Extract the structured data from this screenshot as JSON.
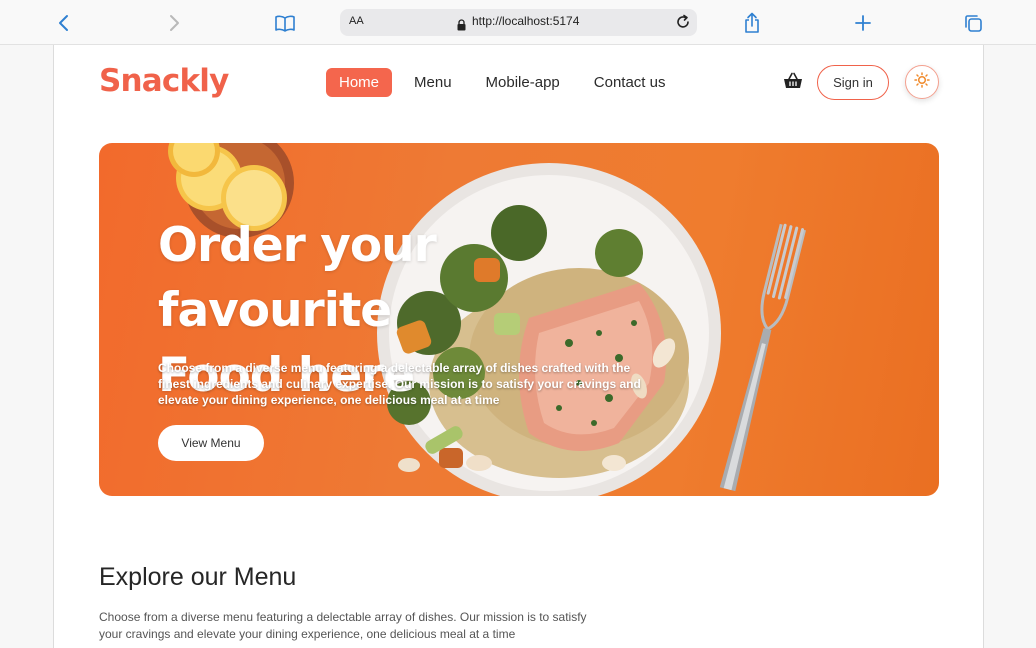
{
  "browser": {
    "text_size_label": "AA",
    "url": "http://localhost:5174",
    "accent_color": "#2f80d1"
  },
  "header": {
    "logo": "Snackly",
    "nav": [
      "Home",
      "Menu",
      "Mobile-app",
      "Contact us"
    ],
    "active_nav": "Home",
    "sign_in_label": "Sign in",
    "brand_color": "#f0624a"
  },
  "hero": {
    "title_line1": "Order your favourite",
    "title_line2": "Food here",
    "description": "Choose from a diverse menu featuring a delectable array of dishes crafted with the finest ingredients and culinary expertise. Our mission is to satisfy your cravings and elevate your dining experience, one delicious meal at a time",
    "cta_label": "View Menu"
  },
  "explore": {
    "title": "Explore our Menu",
    "description": "Choose from a diverse menu featuring a delectable array of dishes. Our mission is to satisfy your cravings and elevate your dining experience, one delicious meal at a time"
  },
  "icons": {
    "back": "chevron-left-icon",
    "forward": "chevron-right-icon",
    "bookmarks": "book-icon",
    "lock": "lock-icon",
    "reload": "reload-icon",
    "share": "share-icon",
    "new_tab": "plus-icon",
    "tabs": "tabs-icon",
    "basket": "basket-icon",
    "theme": "sun-icon"
  }
}
